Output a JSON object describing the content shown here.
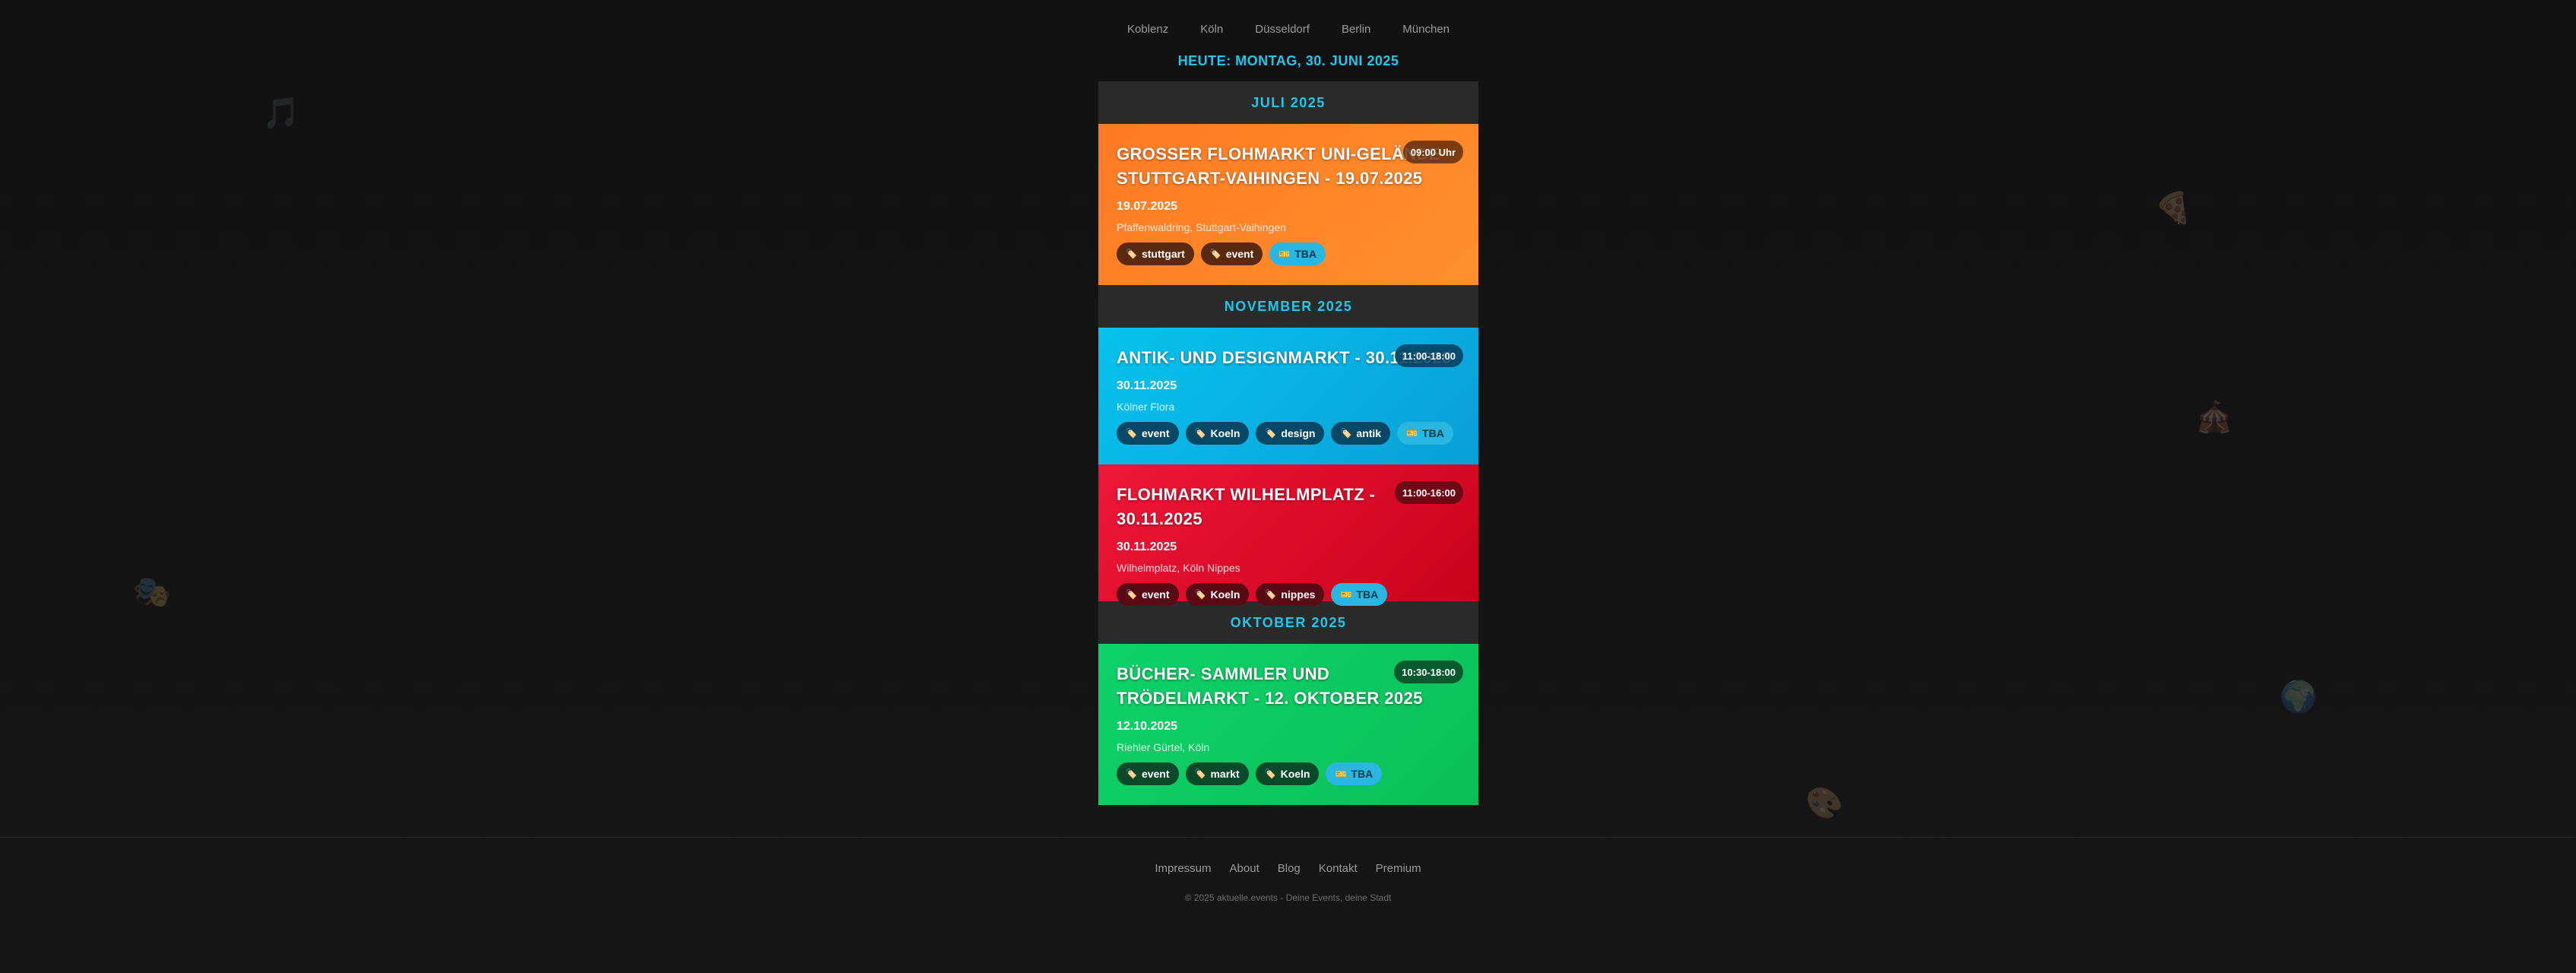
{
  "nav": {
    "cities": [
      "Koblenz",
      "Köln",
      "Düsseldorf",
      "Berlin",
      "München"
    ]
  },
  "today_label": "HEUTE: MONTAG, 30. JUNI 2025",
  "sections": [
    {
      "month": "JULI 2025",
      "events": [
        {
          "title": "GROSSER FLOHMARKT UNI-GELÄNDE STUTTGART-VAIHINGEN - 19.07.2025",
          "time": "09:00 Uhr",
          "date": "19.07.2025",
          "location": "Pfaffenwaldring, Stuttgart-Vaihingen",
          "tags": [
            "stuttgart",
            "event"
          ],
          "tba_label": "TBA",
          "color": "orange"
        }
      ]
    },
    {
      "month": "NOVEMBER 2025",
      "events": [
        {
          "title": "ANTIK- UND DESIGNMARKT - 30.11.2025",
          "time": "11:00-18:00",
          "date": "30.11.2025",
          "location": "Kölner Flora",
          "tags": [
            "event",
            "Koeln",
            "design",
            "antik"
          ],
          "tba_label": "TBA",
          "color": "blue"
        },
        {
          "title": "FLOHMARKT WILHELMPLATZ - 30.11.2025",
          "time": "11:00-16:00",
          "date": "30.11.2025",
          "location": "Wilhelmplatz, Köln Nippes",
          "tags": [
            "event",
            "Koeln",
            "nippes"
          ],
          "tba_label": "TBA",
          "color": "red"
        }
      ]
    },
    {
      "month": "OKTOBER 2025",
      "events": [
        {
          "title": "BÜCHER- SAMMLER UND TRÖDELMARKT - 12. OKTOBER 2025",
          "time": "10:30-18:00",
          "date": "12.10.2025",
          "location": "Riehler Gürtel, Köln",
          "tags": [
            "event",
            "markt",
            "Koeln"
          ],
          "tba_label": "TBA",
          "color": "green"
        }
      ]
    }
  ],
  "footer": {
    "links": [
      "Impressum",
      "About",
      "Blog",
      "Kontakt",
      "Premium"
    ],
    "copyright": "© 2025 aktuelle.events - Deine Events, deine Stadt"
  },
  "colors": {
    "accent": "#22c7ee",
    "orange": "#ff8a2a",
    "blue": "#08b4e4",
    "red": "#e0142e",
    "green": "#0fce66"
  },
  "icons": [
    "tag-icon",
    "ticket-icon",
    "music-note-icon",
    "pizza-icon",
    "circus-tent-icon",
    "theater-masks-icon",
    "globe-icon",
    "palette-icon"
  ]
}
